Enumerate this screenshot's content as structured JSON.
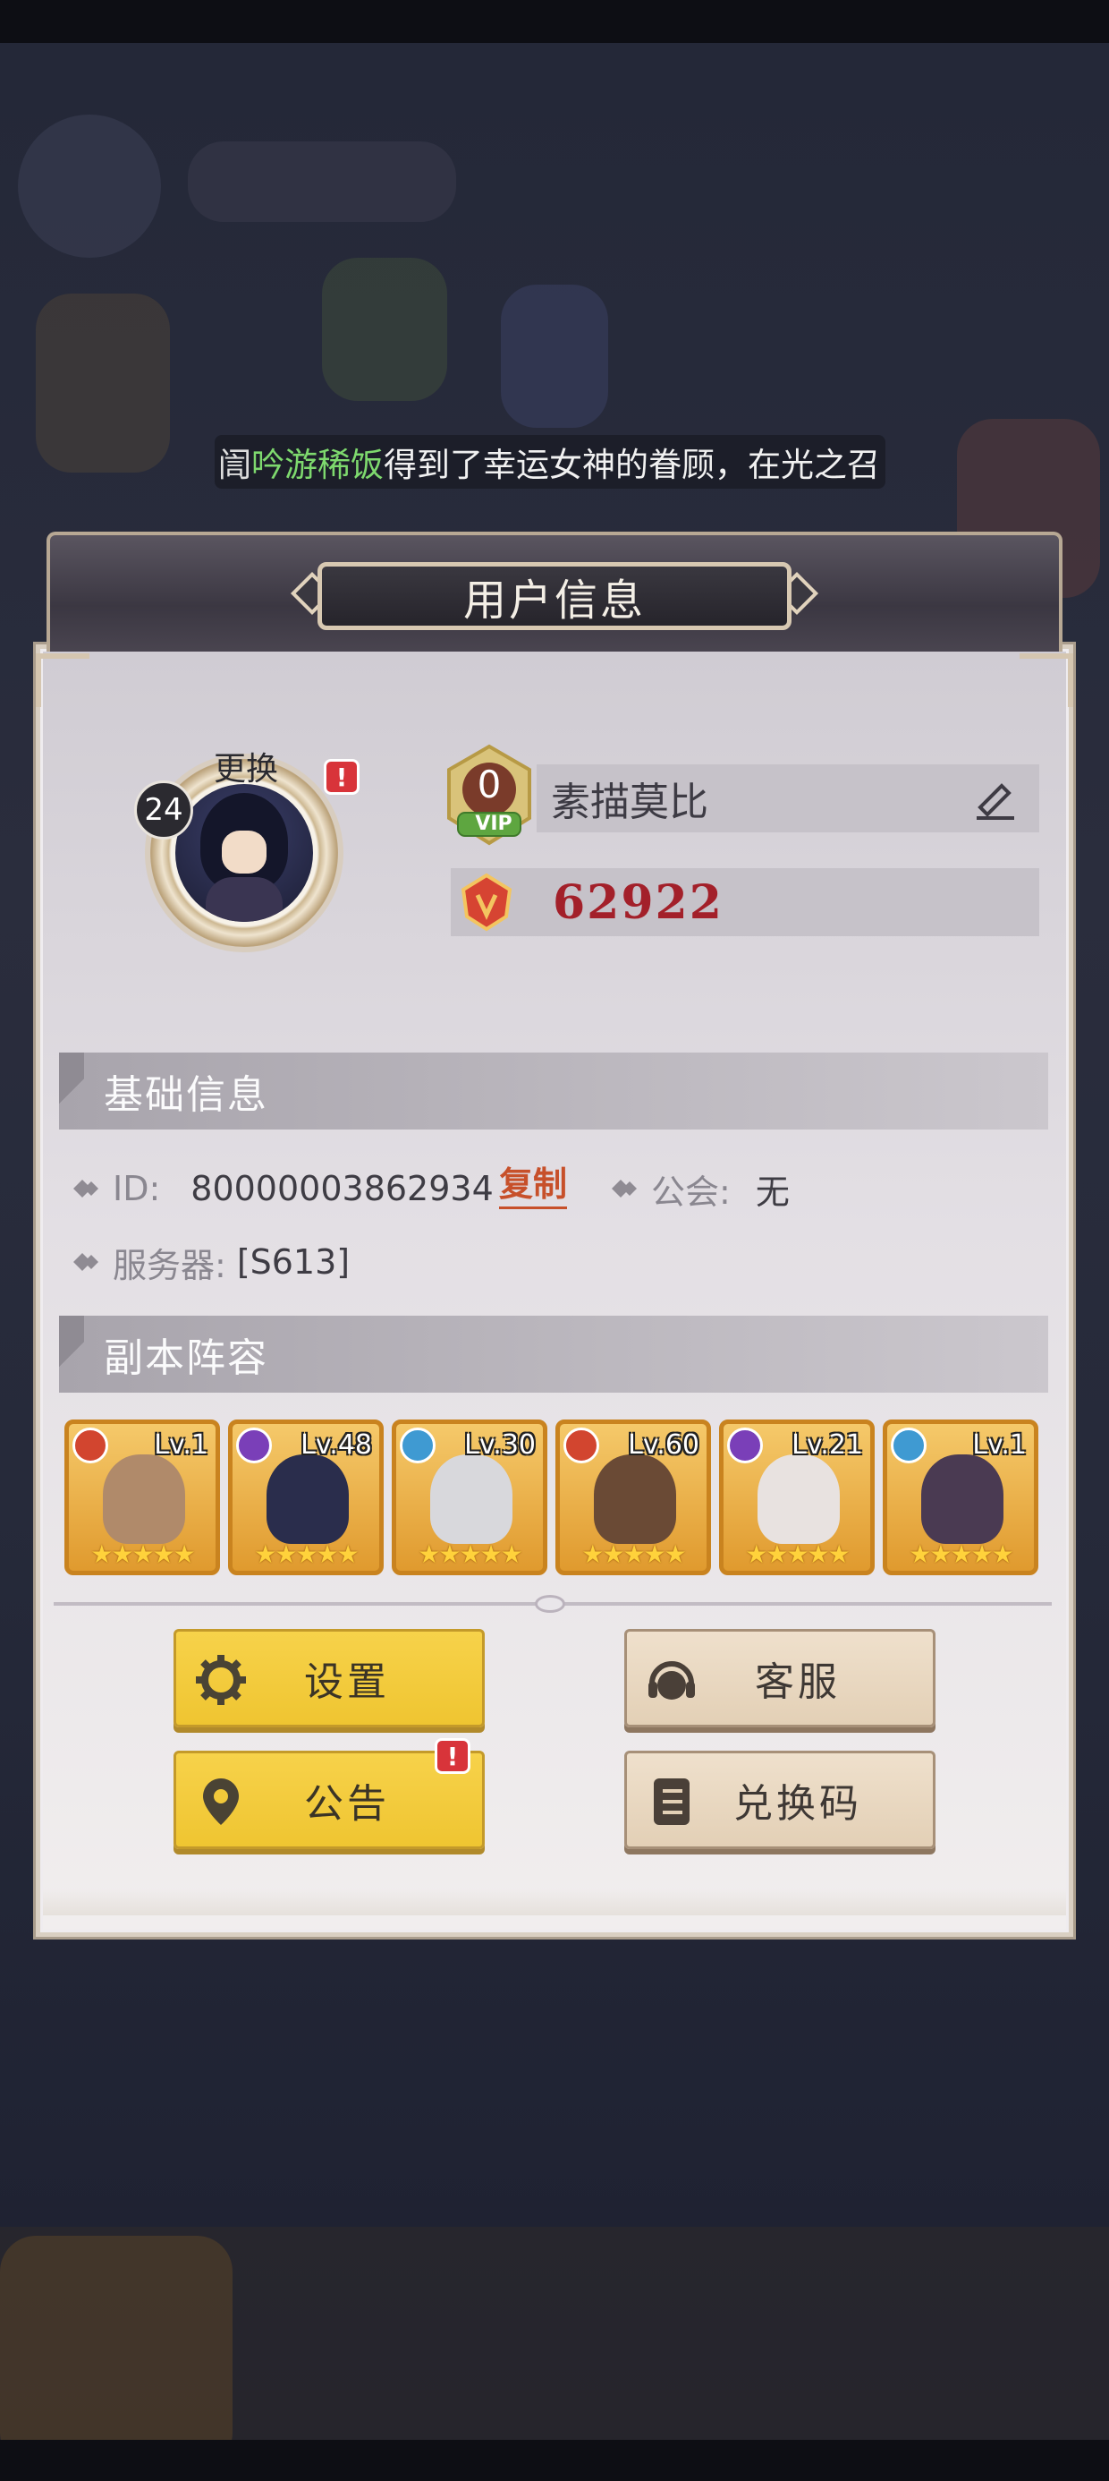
{
  "marquee": {
    "prefix": "訚",
    "player_name": "吟游稀饭",
    "message": "得到了幸运女神的眷顾，在光之召"
  },
  "panel": {
    "title": "用户信息"
  },
  "profile": {
    "change_label": "更换",
    "level": "24",
    "alert_mark": "!",
    "vip_level": "0",
    "vip_text": "VIP",
    "username": "素描莫比",
    "power": "62922"
  },
  "basic_info": {
    "heading": "基础信息",
    "id_label": "ID:",
    "id_value": "80000003862934",
    "copy_label": "复制",
    "guild_label": "公会:",
    "guild_value": "无",
    "server_label": "服务器:",
    "server_value": "[S613]"
  },
  "lineup": {
    "heading": "副本阵容",
    "heroes": [
      {
        "level": "Lv.1",
        "stars": "★★★★★",
        "element": "fire"
      },
      {
        "level": "Lv.48",
        "stars": "★★★★★",
        "element": "dark"
      },
      {
        "level": "Lv.30",
        "stars": "★★★★★",
        "element": "light"
      },
      {
        "level": "Lv.60",
        "stars": "★★★★★",
        "element": "fire"
      },
      {
        "level": "Lv.21",
        "stars": "★★★★★",
        "element": "dark"
      },
      {
        "level": "Lv.1",
        "stars": "★★★★★",
        "element": "light"
      }
    ]
  },
  "buttons": {
    "settings": "设置",
    "service": "客服",
    "notice": "公告",
    "redeem": "兑换码",
    "notice_alert": "!"
  },
  "colors": {
    "accent_yellow": "#f2c93a",
    "power_red": "#a3202a",
    "copy_orange": "#c7502a",
    "alert_red": "#d8343a"
  }
}
